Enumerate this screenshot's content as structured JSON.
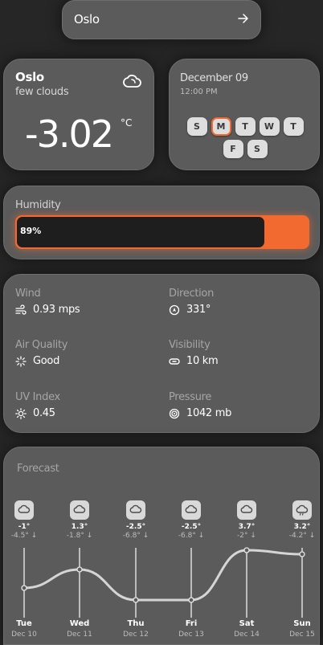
{
  "search": {
    "value": "Oslo",
    "icon": "arrow-right-icon"
  },
  "current": {
    "city": "Oslo",
    "description": "few clouds",
    "temperature": "-3.02",
    "unit": "°C",
    "icon": "cloud-icon"
  },
  "date_card": {
    "date": "December 09",
    "time": "12:00 PM",
    "days": [
      "S",
      "M",
      "T",
      "W",
      "T",
      "F",
      "S"
    ],
    "active_index": 1
  },
  "humidity": {
    "label": "Humidity",
    "value_text": "89%",
    "value": 0.89
  },
  "details": {
    "wind": {
      "label": "Wind",
      "value": "0.93 mps",
      "icon": "wind-icon"
    },
    "direction": {
      "label": "Direction",
      "value": "331°",
      "icon": "compass-icon"
    },
    "air_quality": {
      "label": "Air Quality",
      "value": "Good",
      "icon": "sparkle-icon"
    },
    "visibility": {
      "label": "Visibility",
      "value": "10 km",
      "icon": "eye-icon"
    },
    "uv_index": {
      "label": "UV Index",
      "value": "0.45",
      "icon": "sun-icon"
    },
    "pressure": {
      "label": "Pressure",
      "value": "1042 mb",
      "icon": "pressure-icon"
    }
  },
  "forecast": {
    "title": "Forecast",
    "days": [
      {
        "day": "Tue",
        "date": "Dec 10",
        "max": "-1°",
        "min": "-4.5°",
        "icon": "cloud-icon"
      },
      {
        "day": "Wed",
        "date": "Dec 11",
        "max": "1.3°",
        "min": "-1.8°",
        "icon": "cloud-icon"
      },
      {
        "day": "Thu",
        "date": "Dec 12",
        "max": "-2.5°",
        "min": "-6.8°",
        "icon": "cloud-icon"
      },
      {
        "day": "Fri",
        "date": "Dec 13",
        "max": "-2.5°",
        "min": "-6.8°",
        "icon": "cloud-icon"
      },
      {
        "day": "Sat",
        "date": "Dec 14",
        "max": "3.7°",
        "min": "-2°",
        "icon": "cloud-icon"
      },
      {
        "day": "Sun",
        "date": "Dec 15",
        "max": "3.2°",
        "min": "-4.2°",
        "icon": "cloud-rain-icon"
      }
    ],
    "series_max": [
      -1,
      1.3,
      -2.5,
      -2.5,
      3.7,
      3.2
    ]
  },
  "colors": {
    "accent": "#f26a2f",
    "card": "#5b5b5b",
    "background": "#262626"
  }
}
